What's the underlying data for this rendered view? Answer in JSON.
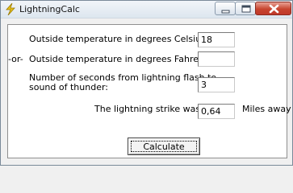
{
  "window": {
    "title": "LightningCalc",
    "icon": "lightning-icon",
    "controls": {
      "minimize": "minimize-icon",
      "maximize": "maximize-icon",
      "close": "close-icon"
    }
  },
  "form": {
    "celsius_label": "Outside temperature in degrees Celsius:",
    "celsius_value": "18",
    "or_label": "-or-",
    "fahrenheit_label": "Outside temperature in degrees Fahreheit:",
    "fahrenheit_value": "",
    "seconds_label_line1": "Number of seconds from lightning flash to",
    "seconds_label_line2": "sound of thunder:",
    "seconds_value": "3",
    "result_label": "The lightning strike was:",
    "result_value": "0,64",
    "result_unit": "Miles away",
    "calculate_label": "Calculate"
  },
  "colors": {
    "close_button": "#c7452f",
    "lightning": "#e8c21a"
  }
}
